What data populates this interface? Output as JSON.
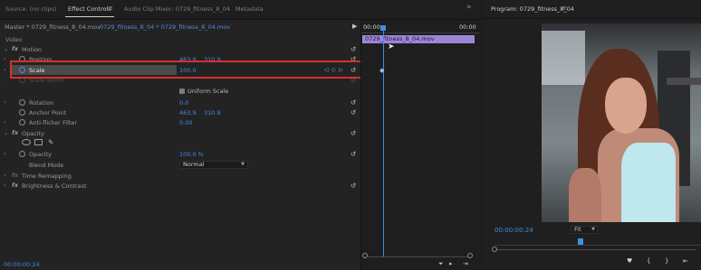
{
  "tabs": [
    {
      "label": "Source: (no clips)"
    },
    {
      "label": "Effect Controls"
    },
    {
      "label": "Audio Clip Mixer: 0729_fitness_8_04"
    },
    {
      "label": "Metadata"
    }
  ],
  "effect_controls": {
    "menu_icon": "≡",
    "more_icon": "»",
    "master_source": "Master * 0729_fitness_8_04.mov",
    "master_sequence": "0729_fitness_8_04 * 0729_fitness_8_04.mov",
    "section": "Video",
    "motion": {
      "name": "Motion",
      "position": {
        "label": "Position",
        "x": "463.9",
        "y": "310.9"
      },
      "scale": {
        "label": "Scale",
        "value": "100.0"
      },
      "scale_width": {
        "label": "Scale Width"
      },
      "uniform_scale": {
        "label": "Uniform Scale",
        "checked": true
      },
      "rotation": {
        "label": "Rotation",
        "value": "0.0"
      },
      "anchor_point": {
        "label": "Anchor Point",
        "x": "463.9",
        "y": "310.9"
      },
      "anti_flicker": {
        "label": "Anti-flicker Filter",
        "value": "0.00"
      }
    },
    "opacity": {
      "name": "Opacity",
      "value_label": "Opacity",
      "value": "100.0 %",
      "blend_label": "Blend Mode",
      "blend_value": "Normal"
    },
    "time_remapping": {
      "name": "Time Remapping"
    },
    "brightness_contrast": {
      "name": "Brightness & Contrast"
    },
    "keyframe_nav": {
      "prev": "◁",
      "add": "◇",
      "next": "▷"
    },
    "bottom_time": "00:00:00:24"
  },
  "mini_timeline": {
    "start": "00:00",
    "end": "00:00",
    "clip_label": "0729_fitness_8_04.mov"
  },
  "program": {
    "title": "Program: 0729_fitness_8_04",
    "menu_icon": "≡",
    "timecode": "00:00:00:24",
    "fit": "Fit",
    "controls": [
      "♥",
      "{",
      "}",
      "⇤"
    ]
  },
  "colors": {
    "accent": "#3d8ee6",
    "highlight_box": "#d6302e",
    "clip": "#9d86d8"
  }
}
